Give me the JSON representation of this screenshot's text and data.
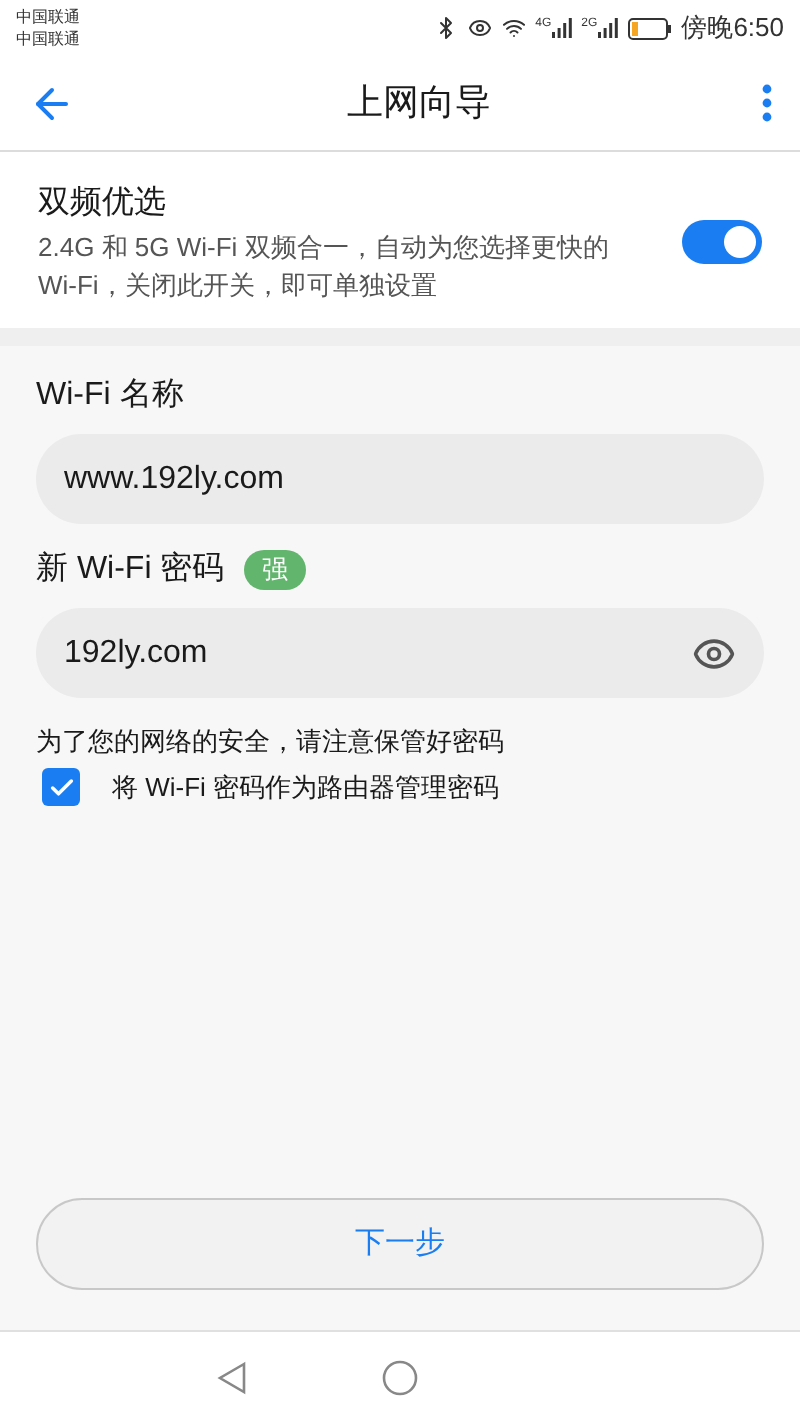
{
  "status_bar": {
    "carriers": [
      "中国联通",
      "中国联通"
    ],
    "network_labels": [
      "4G",
      "2G"
    ],
    "time": "傍晚6:50"
  },
  "app_bar": {
    "title": "上网向导"
  },
  "dual_band": {
    "title": "双频优选",
    "description": "2.4G 和 5G Wi-Fi 双频合一，自动为您选择更快的 Wi-Fi，关闭此开关，即可单独设置",
    "on": true
  },
  "wifi_name": {
    "label": "Wi-Fi 名称",
    "value": "www.192ly.com"
  },
  "wifi_password": {
    "label": "新 Wi-Fi 密码",
    "strength": "强",
    "value": "192ly.com"
  },
  "security_note": "为了您的网络的安全，请注意保管好密码",
  "admin_password_option": {
    "label": "将 Wi-Fi 密码作为路由器管理密码",
    "checked": true
  },
  "next_button": "下一步"
}
